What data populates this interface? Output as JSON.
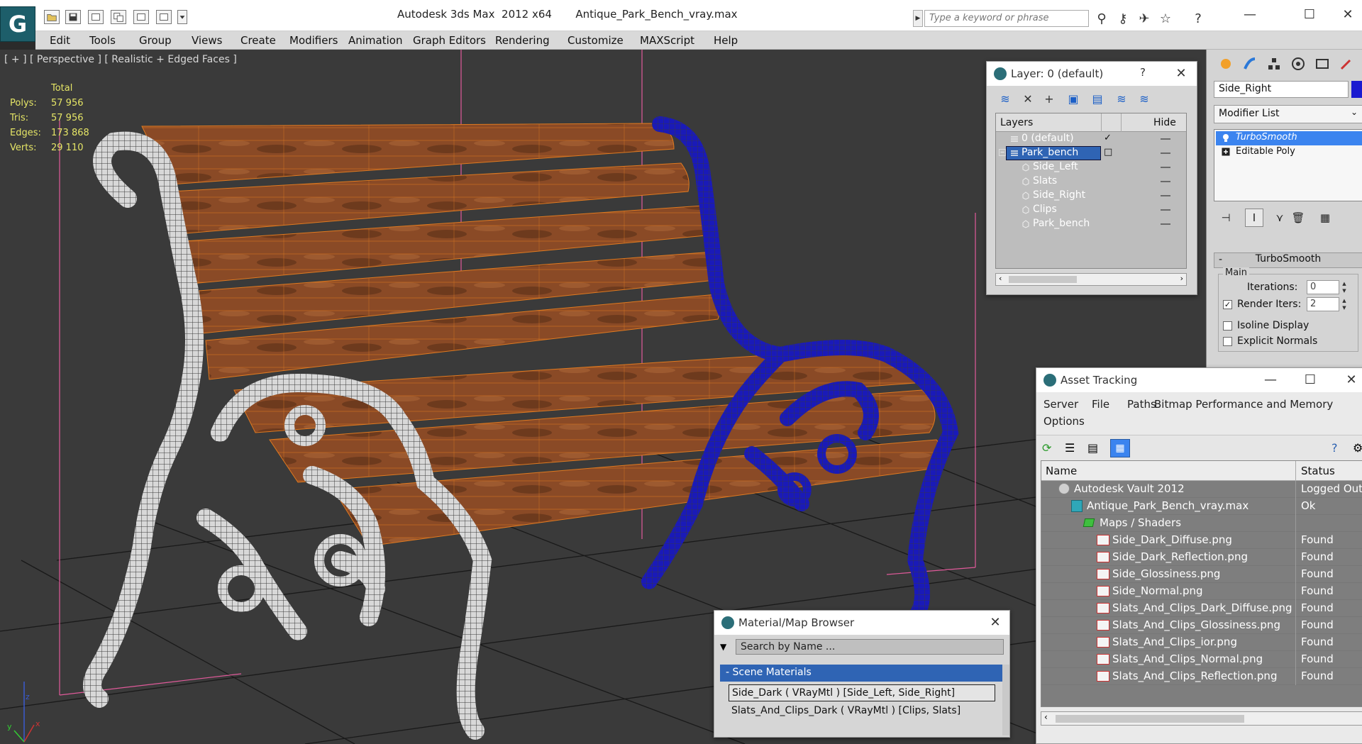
{
  "titlebar": {
    "title": "Autodesk 3ds Max  2012 x64       Antique_Park_Bench_vray.max",
    "search_placeholder": "Type a keyword or phrase",
    "app_logo_letter": "G"
  },
  "menu": [
    "Edit",
    "Tools",
    "Group",
    "Views",
    "Create",
    "Modifiers",
    "Animation",
    "Graph Editors",
    "Rendering",
    "Customize",
    "MAXScript",
    "Help"
  ],
  "viewport": {
    "label": "[ + ] [ Perspective ] [ Realistic + Edged Faces ]",
    "stats": {
      "header": "Total",
      "rows": [
        {
          "k": "Polys:",
          "v": "57 956"
        },
        {
          "k": "Tris:",
          "v": "57 956"
        },
        {
          "k": "Edges:",
          "v": "173 868"
        },
        {
          "k": "Verts:",
          "v": "29 110"
        }
      ]
    },
    "axis": {
      "z": "z",
      "x": "x",
      "y": "y"
    },
    "colors": {
      "wood": "#8a4a26",
      "wire_left": "#ffffff",
      "wire_right": "#1a1ab8",
      "grid": "#000000",
      "guides": "#e05a9a"
    }
  },
  "command_panel": {
    "object_name": "Side_Right",
    "object_color": "#1a1ad0",
    "modifier_list_label": "Modifier List",
    "stack": [
      {
        "label": "TurboSmooth",
        "selected": true
      },
      {
        "label": "Editable Poly",
        "selected": false
      }
    ],
    "rollout_title": "TurboSmooth",
    "group_label": "Main",
    "iterations_label": "Iterations:",
    "iterations_value": "0",
    "render_iters_label": "Render Iters:",
    "render_iters_value": "2",
    "render_iters_checked": true,
    "isoline_label": "Isoline Display",
    "explicit_normals_label": "Explicit Normals"
  },
  "layer_window": {
    "title": "Layer: 0 (default)",
    "help": "?",
    "col_layers": "Layers",
    "col_hide": "Hide",
    "rows": [
      {
        "name": "0 (default)",
        "indent": 0,
        "selected": false,
        "check": "✓"
      },
      {
        "name": "Park_bench",
        "indent": 0,
        "selected": true,
        "check": "□"
      },
      {
        "name": "Side_Left",
        "indent": 1,
        "selected": false,
        "check": ""
      },
      {
        "name": "Slats",
        "indent": 1,
        "selected": false,
        "check": ""
      },
      {
        "name": "Side_Right",
        "indent": 1,
        "selected": false,
        "check": ""
      },
      {
        "name": "Clips",
        "indent": 1,
        "selected": false,
        "check": ""
      },
      {
        "name": "Park_bench",
        "indent": 1,
        "selected": false,
        "check": ""
      }
    ]
  },
  "asset_window": {
    "title": "Asset Tracking",
    "menu": [
      "Server",
      "File",
      "Paths",
      "Bitmap Performance and Memory"
    ],
    "menu2": "Options",
    "col_name": "Name",
    "col_status": "Status",
    "rows": [
      {
        "name": "Autodesk Vault 2012",
        "status": "Logged Out ...",
        "indent": 0,
        "icon": "vault"
      },
      {
        "name": "Antique_Park_Bench_vray.max",
        "status": "Ok",
        "indent": 1,
        "icon": "max"
      },
      {
        "name": "Maps / Shaders",
        "status": "",
        "indent": 2,
        "icon": "folder"
      },
      {
        "name": "Side_Dark_Diffuse.png",
        "status": "Found",
        "indent": 3,
        "icon": "png"
      },
      {
        "name": "Side_Dark_Reflection.png",
        "status": "Found",
        "indent": 3,
        "icon": "png"
      },
      {
        "name": "Side_Glossiness.png",
        "status": "Found",
        "indent": 3,
        "icon": "png"
      },
      {
        "name": "Side_Normal.png",
        "status": "Found",
        "indent": 3,
        "icon": "png"
      },
      {
        "name": "Slats_And_Clips_Dark_Diffuse.png",
        "status": "Found",
        "indent": 3,
        "icon": "png"
      },
      {
        "name": "Slats_And_Clips_Glossiness.png",
        "status": "Found",
        "indent": 3,
        "icon": "png"
      },
      {
        "name": "Slats_And_Clips_ior.png",
        "status": "Found",
        "indent": 3,
        "icon": "png"
      },
      {
        "name": "Slats_And_Clips_Normal.png",
        "status": "Found",
        "indent": 3,
        "icon": "png"
      },
      {
        "name": "Slats_And_Clips_Reflection.png",
        "status": "Found",
        "indent": 3,
        "icon": "png"
      }
    ]
  },
  "material_window": {
    "title": "Material/Map Browser",
    "search_placeholder": "Search by Name ...",
    "group_label": "- Scene Materials",
    "rows": [
      {
        "label": "Side_Dark  ( VRayMtl ) [Side_Left, Side_Right]",
        "selected": true
      },
      {
        "label": "Slats_And_Clips_Dark  ( VRayMtl ) [Clips, Slats]",
        "selected": false
      }
    ]
  }
}
